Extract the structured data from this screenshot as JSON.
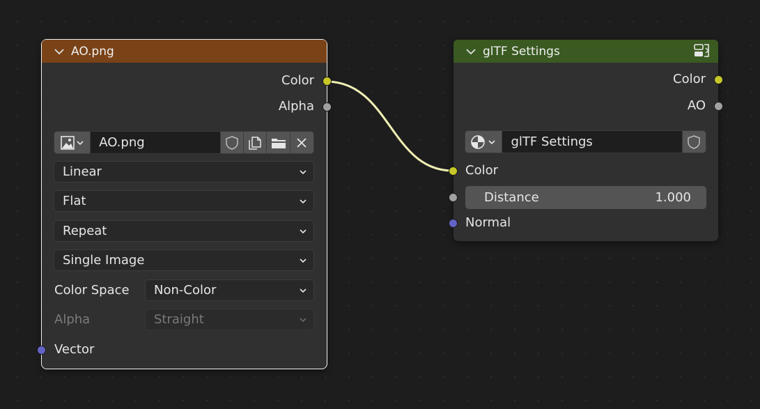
{
  "colors": {
    "image_node_header": "#7a4217",
    "group_node_header": "#3a5a22",
    "link": "#efefb4",
    "socket_color": "#c7c729",
    "socket_float": "#a1a1a1",
    "socket_vector": "#6363c7"
  },
  "image_node": {
    "title": "AO.png",
    "outputs": [
      "Color",
      "Alpha"
    ],
    "image_name": "AO.png",
    "interpolation": "Linear",
    "projection": "Flat",
    "extension": "Repeat",
    "source": "Single Image",
    "color_space_label": "Color Space",
    "color_space": "Non-Color",
    "alpha_label": "Alpha",
    "alpha_mode": "Straight",
    "input_vector": "Vector",
    "icons": [
      "image-icon",
      "fake-user-shield-icon",
      "duplicate-icon",
      "folder-icon",
      "close-icon"
    ]
  },
  "group_node": {
    "title": "glTF Settings",
    "outputs": [
      "Color",
      "AO"
    ],
    "node_tree_name": "glTF Settings",
    "inputs": {
      "color": "Color",
      "distance_label": "Distance",
      "distance_value": "1.000",
      "normal": "Normal"
    },
    "icons": [
      "node-tree-icon",
      "fake-user-shield-icon",
      "node-group-icon"
    ]
  }
}
